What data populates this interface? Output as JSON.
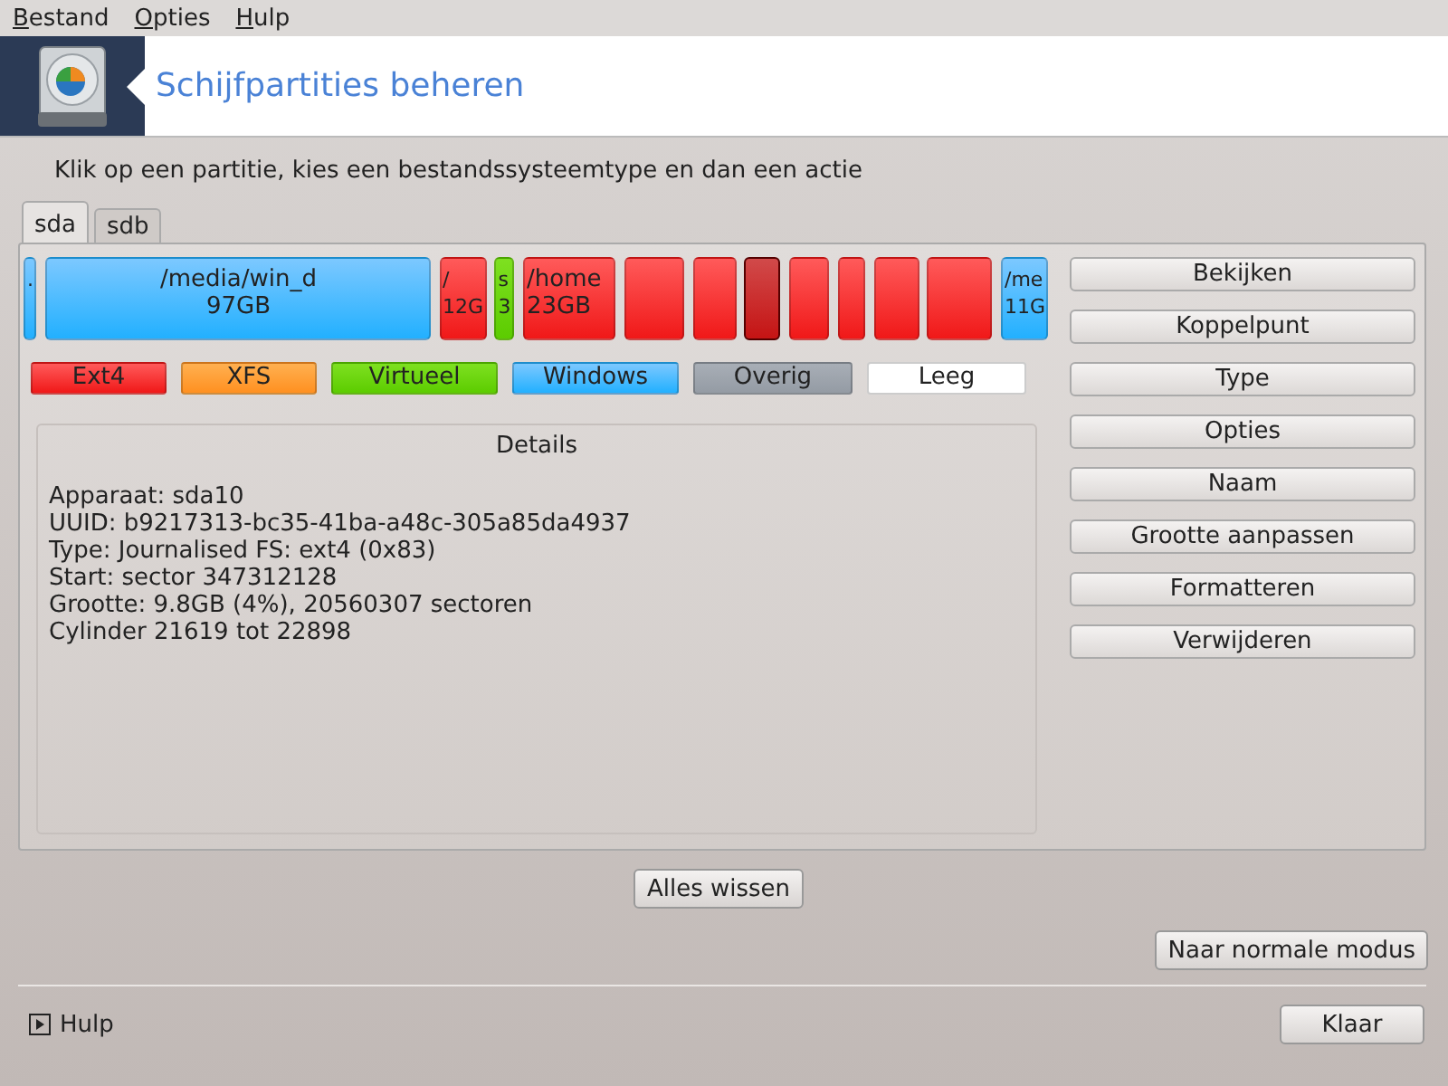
{
  "menu": [
    {
      "label": "Bestand"
    },
    {
      "label": "Opties"
    },
    {
      "label": "Hulp"
    }
  ],
  "header": {
    "title": "Schijfpartities beheren"
  },
  "instruction": "Klik op een partitie, kies een bestandssysteemtype en dan een actie",
  "tabs": [
    {
      "label": "sda",
      "selected": true
    },
    {
      "label": "sdb",
      "selected": false
    }
  ],
  "partitions": [
    {
      "kind": "windows",
      "lines": [
        "."
      ],
      "selected": false
    },
    {
      "kind": "windows",
      "lines": [
        "/media/win_d",
        "97GB"
      ],
      "selected": false
    },
    {
      "kind": "ext4",
      "lines": [
        "/",
        "12G"
      ],
      "selected": false
    },
    {
      "kind": "virtual",
      "lines": [
        "s",
        "3"
      ],
      "selected": false
    },
    {
      "kind": "ext4",
      "lines": [
        "/home",
        "23GB"
      ],
      "selected": false
    },
    {
      "kind": "ext4",
      "selected": false
    },
    {
      "kind": "ext4",
      "selected": false
    },
    {
      "kind": "ext4",
      "selected": true
    },
    {
      "kind": "ext4",
      "selected": false
    },
    {
      "kind": "ext4",
      "selected": false
    },
    {
      "kind": "ext4",
      "selected": false
    },
    {
      "kind": "ext4",
      "selected": false
    },
    {
      "kind": "windows",
      "lines": [
        "/me",
        "11G"
      ],
      "selected": false
    }
  ],
  "legend": [
    {
      "kind": "ext4",
      "label": "Ext4"
    },
    {
      "kind": "xfs",
      "label": "XFS"
    },
    {
      "kind": "virtual",
      "label": "Virtueel"
    },
    {
      "kind": "windows",
      "label": "Windows"
    },
    {
      "kind": "other",
      "label": "Overig"
    },
    {
      "kind": "empty",
      "label": "Leeg"
    }
  ],
  "details": {
    "title": "Details",
    "lines": [
      "Apparaat: sda10",
      "UUID: b9217313-bc35-41ba-a48c-305a85da4937",
      "Type: Journalised FS: ext4 (0x83)",
      "Start: sector 347312128",
      "Grootte: 9.8GB (4%), 20560307 sectoren",
      "Cylinder 21619 tot 22898"
    ]
  },
  "actions": [
    "Bekijken",
    "Koppelpunt",
    "Type",
    "Opties",
    "Naam",
    "Grootte aanpassen",
    "Formatteren",
    "Verwijderen"
  ],
  "clear_button": "Alles wissen",
  "mode_button": "Naar normale modus",
  "help": "Hulp",
  "done_button": "Klaar"
}
